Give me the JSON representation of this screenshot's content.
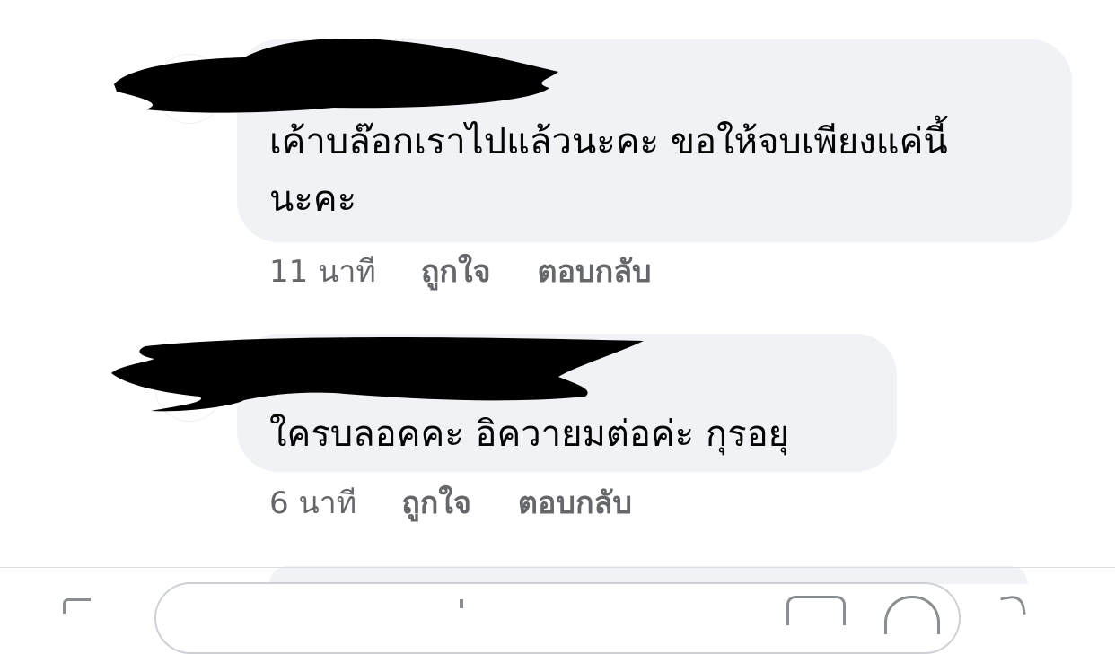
{
  "comments": [
    {
      "text": "เค้าบล๊อกเราไปแล้วนะคะ ขอให้จบเพียงแค่นี้\nนะคะ",
      "time": "11 นาที",
      "like_label": "ถูกใจ",
      "reply_label": "ตอบกลับ"
    },
    {
      "text": "ใครบลอคคะ อิควายมต่อค่ะ กุรอยุ",
      "time": "6 นาที",
      "like_label": "ถูกใจ",
      "reply_label": "ตอบกลับ"
    }
  ],
  "icons": {
    "camera": "camera-icon",
    "gif": "gif-icon",
    "emoji": "emoji-icon",
    "sticker": "sticker-icon"
  },
  "colors": {
    "bubble_bg": "#f0f2f5",
    "meta_text": "#65676b",
    "comment_text": "#050505",
    "redaction": "#000000"
  }
}
